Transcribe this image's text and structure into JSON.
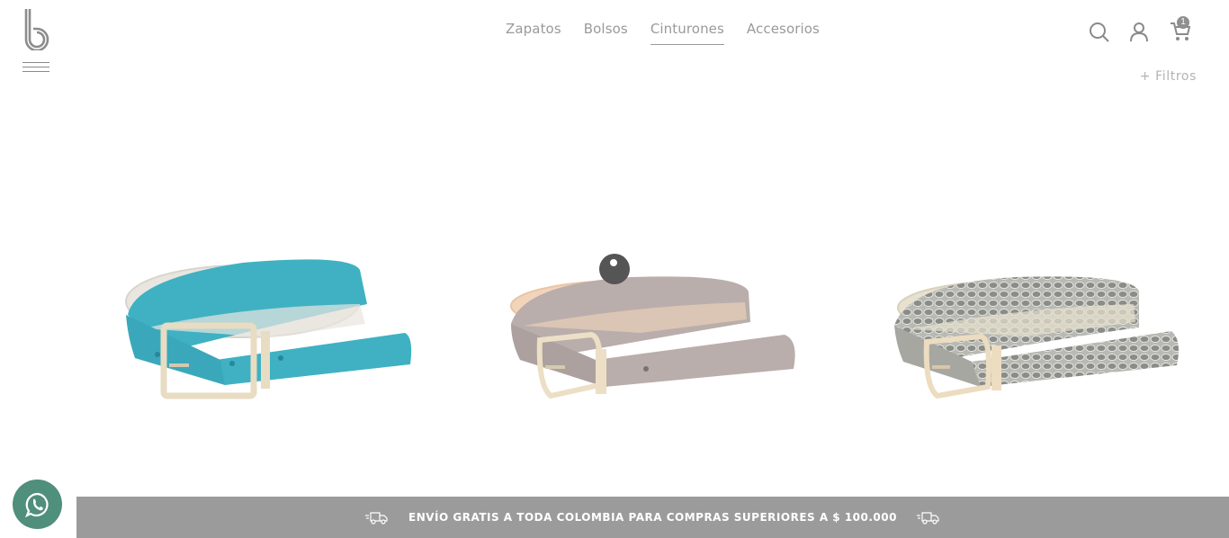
{
  "brand": {
    "logo_icon": "b-logo-icon"
  },
  "nav": {
    "items": [
      {
        "label": "Zapatos"
      },
      {
        "label": "Bolsos"
      },
      {
        "label": "Cinturones",
        "active": true
      },
      {
        "label": "Accesorios"
      }
    ]
  },
  "header_icons": {
    "search": "search-icon",
    "account": "user-icon",
    "cart": "cart-icon",
    "cart_count": "1"
  },
  "filters_label": "+ Filtros",
  "products": [
    {
      "name": "belt-turquoise",
      "color": "#3fb1c3"
    },
    {
      "name": "belt-taupe",
      "color": "#b9aeab"
    },
    {
      "name": "belt-snakeskin",
      "color": "#a9aaa5"
    }
  ],
  "promo": {
    "text": "ENVÍO GRATIS A TODA COLOMBIA PARA COMPRAS SUPERIORES A $ 100.000",
    "icon": "delivery-truck-icon",
    "background": "#9b9b9b"
  },
  "whatsapp": {
    "icon": "whatsapp-icon",
    "color": "#4f8f7b"
  }
}
